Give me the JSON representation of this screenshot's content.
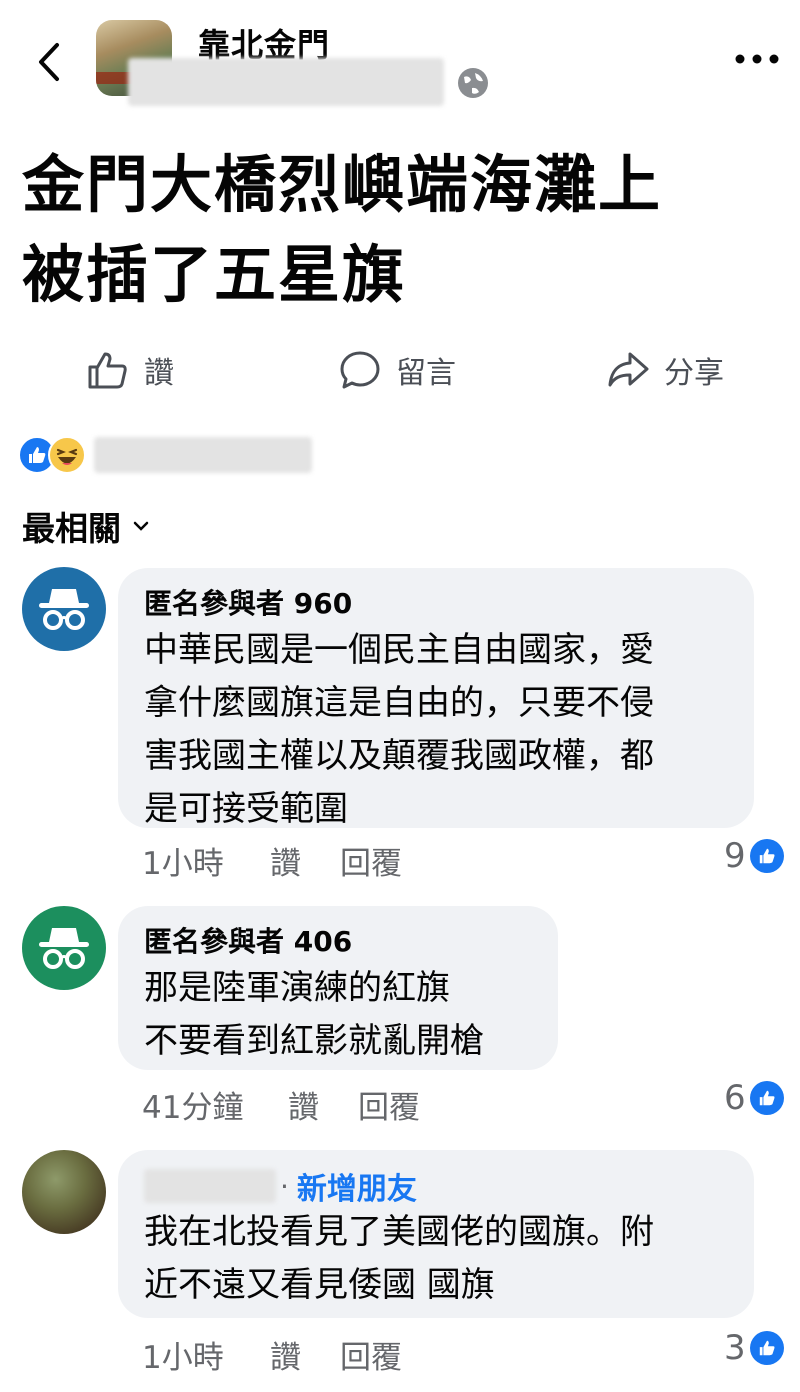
{
  "header": {
    "page_name": "靠北金門"
  },
  "post": {
    "title_line1": "金門大橋烈嶼端海灘上",
    "title_line2": "被插了五星旗"
  },
  "actions": {
    "like": "讚",
    "comment": "留言",
    "share": "分享"
  },
  "sort": {
    "label": "最相關"
  },
  "comments": [
    {
      "author": "匿名參與者 960",
      "text": "中華民國是一個民主自由國家，愛\n拿什麼國旗這是自由的，只要不侵\n害我國主權以及顛覆我國政權，都\n是可接受範圍",
      "time": "1小時",
      "like_label": "讚",
      "reply_label": "回覆",
      "likes": "9",
      "avatar_color": "#1f6fa8"
    },
    {
      "author": "匿名參與者 406",
      "text": "那是陸軍演練的紅旗\n不要看到紅影就亂開槍",
      "time": "41分鐘",
      "like_label": "讚",
      "reply_label": "回覆",
      "likes": "6",
      "avatar_color": "#1c8f5e"
    },
    {
      "author_dot": "·",
      "add_friend": "新增朋友",
      "text": "我在北投看見了美國佬的國旗。附\n近不遠又看見倭國  國旗",
      "time": "1小時",
      "like_label": "讚",
      "reply_label": "回覆",
      "likes": "3"
    }
  ],
  "colors": {
    "accent": "#1877f2",
    "bubble": "#f0f2f5",
    "muted_text": "#65676b"
  }
}
